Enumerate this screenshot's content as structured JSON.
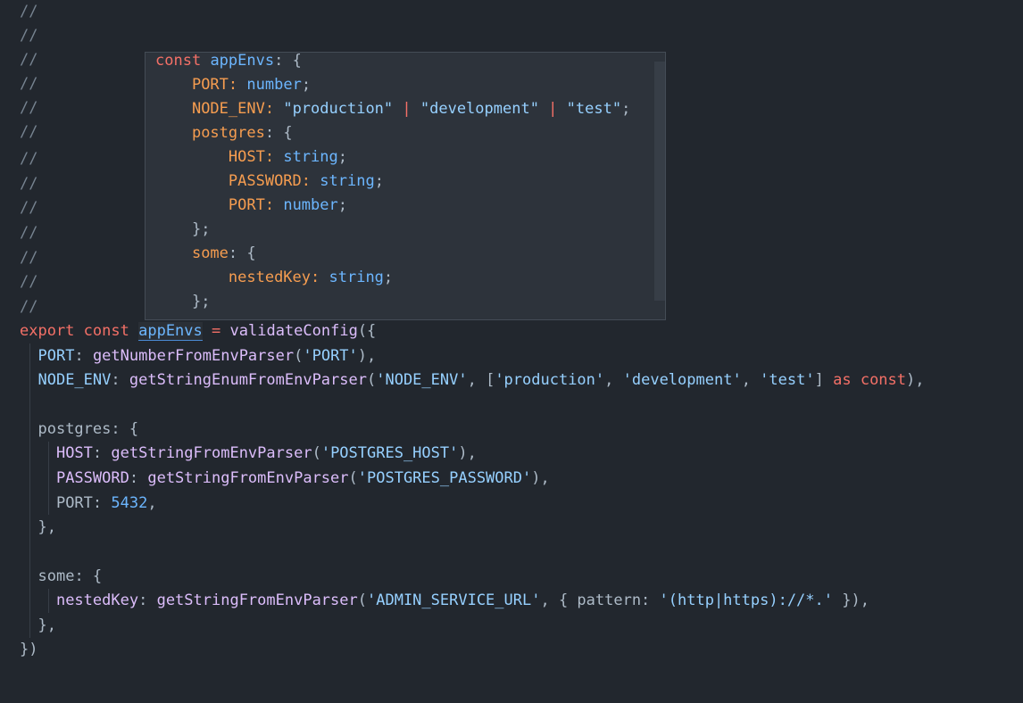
{
  "comment_marker": "//",
  "code": {
    "l13": {
      "kw_export": "export",
      "kw_const": "const",
      "name": "appEnvs",
      "eq": "=",
      "fn": "validateConfig",
      "open": "({"
    },
    "l14": {
      "key": "PORT",
      "colon": ":",
      "fn": "getNumberFromEnvParser",
      "arg": "'PORT'",
      "close": "),"
    },
    "l15": {
      "key": "NODE_ENV",
      "colon": ":",
      "fn": "getStringEnumFromEnvParser",
      "arg1": "'NODE_ENV'",
      "comma": ", [",
      "opt1": "'production'",
      "opt2": "'development'",
      "opt3": "'test'",
      "bracket_close": "]",
      "kw_as": "as",
      "kw_const": "const",
      "close": "),"
    },
    "l17": {
      "key": "postgres",
      "open": ": {"
    },
    "l18": {
      "key": "HOST",
      "colon": ":",
      "fn": "getStringFromEnvParser",
      "arg": "'POSTGRES_HOST'",
      "close": "),"
    },
    "l19": {
      "key": "PASSWORD",
      "colon": ":",
      "fn": "getStringFromEnvParser",
      "arg": "'POSTGRES_PASSWORD'",
      "close": "),"
    },
    "l20": {
      "key": "PORT",
      "colon": ":",
      "value": "5432",
      "comma": ","
    },
    "l21": {
      "text": "},"
    },
    "l23": {
      "key": "some",
      "open": ": {"
    },
    "l24": {
      "key": "nestedKey",
      "colon": ":",
      "fn": "getStringFromEnvParser",
      "arg": "'ADMIN_SERVICE_URL'",
      "mid": ", { pattern: ",
      "pattern": "'(http|https)://*.'",
      "close": " }),"
    },
    "l25": {
      "text": "},"
    },
    "l26": {
      "text": "})"
    }
  },
  "hover": {
    "h1": {
      "kw": "const",
      "name": "appEnvs",
      "rest": ": {"
    },
    "h2": {
      "key": "PORT",
      "colon": ": ",
      "type": "number",
      "end": ";"
    },
    "h3": {
      "key": "NODE_ENV",
      "colon": ": ",
      "v1": "\"production\"",
      "pipe1": " | ",
      "v2": "\"development\"",
      "pipe2": " | ",
      "v3": "\"test\"",
      "end": ";"
    },
    "h4": {
      "key": "postgres",
      "open": ": {"
    },
    "h5": {
      "key": "HOST",
      "colon": ": ",
      "type": "string",
      "end": ";"
    },
    "h6": {
      "key": "PASSWORD",
      "colon": ": ",
      "type": "string",
      "end": ";"
    },
    "h7": {
      "key": "PORT",
      "colon": ": ",
      "type": "number",
      "end": ";"
    },
    "h8": {
      "text": "};"
    },
    "h9": {
      "key": "some",
      "open": ": {"
    },
    "h10": {
      "key": "nestedKey",
      "colon": ": ",
      "type": "string",
      "end": ";"
    },
    "h11": {
      "text": "};"
    }
  },
  "colors": {
    "background": "#22272e",
    "popup_background": "#2d333b",
    "keyword": "#f47067",
    "function": "#dcbdfb",
    "string": "#96d0ff",
    "number": "#6cb6ff",
    "property": "#f69d50"
  }
}
